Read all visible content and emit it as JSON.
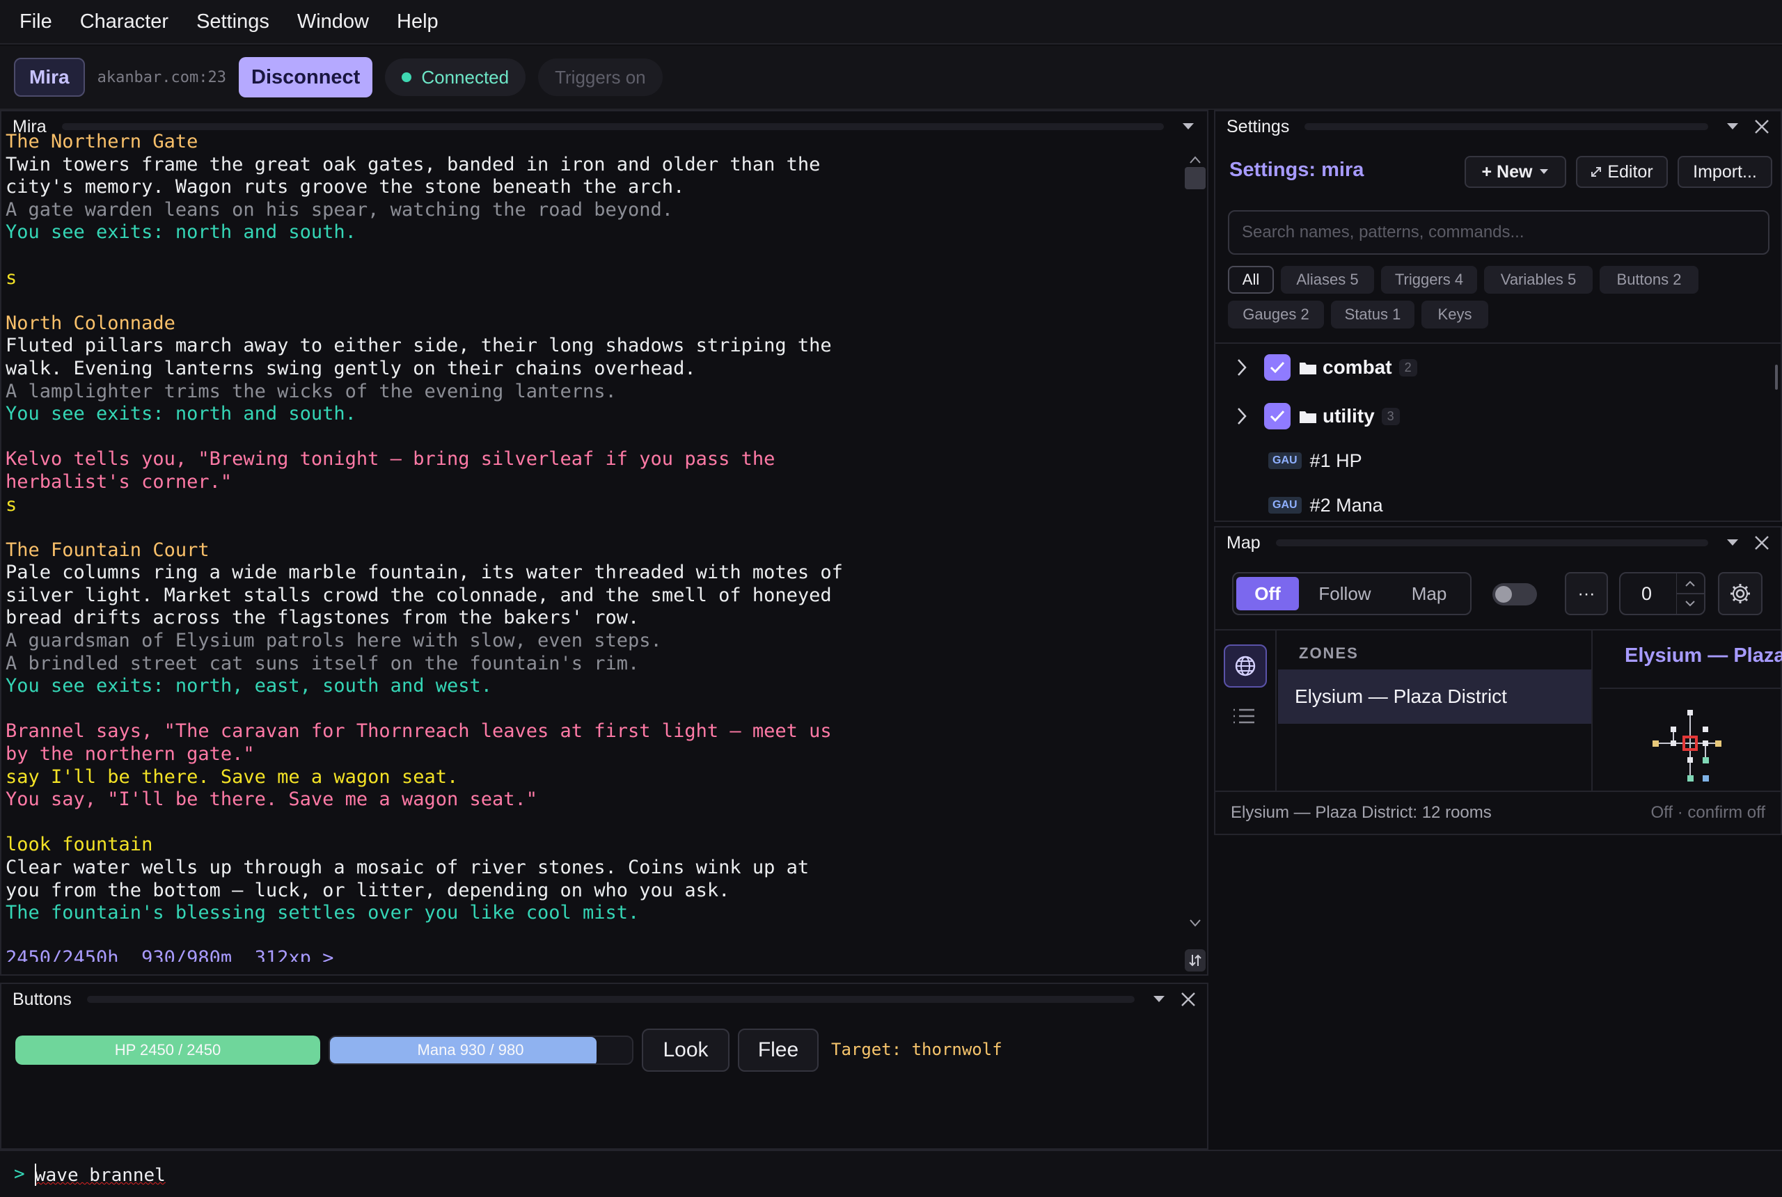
{
  "menu": [
    "File",
    "Character",
    "Settings",
    "Window",
    "Help"
  ],
  "connection": {
    "character": "Mira",
    "host": "akanbar.com:23",
    "disconnect": "Disconnect",
    "status": "Connected",
    "triggers": "Triggers on"
  },
  "output": {
    "title": "Mira",
    "lines": [
      {
        "t": "The Northern Gate",
        "c": "room"
      },
      {
        "t": "Twin towers frame the great oak gates, banded in iron and older than the",
        "c": "desc"
      },
      {
        "t": "city's memory. Wagon ruts groove the stone beneath the arch.",
        "c": "desc"
      },
      {
        "t": "A gate warden leans on his spear, watching the road beyond.",
        "c": "npc"
      },
      {
        "t": "You see exits: north and south.",
        "c": "exit"
      },
      {
        "t": "",
        "c": "desc"
      },
      {
        "t": "s",
        "c": "cmd"
      },
      {
        "t": "",
        "c": "desc"
      },
      {
        "t": "North Colonnade",
        "c": "room"
      },
      {
        "t": "Fluted pillars march away to either side, their long shadows striping the",
        "c": "desc"
      },
      {
        "t": "walk. Evening lanterns swing gently on their chains overhead.",
        "c": "desc"
      },
      {
        "t": "A lamplighter trims the wicks of the evening lanterns.",
        "c": "npc"
      },
      {
        "t": "You see exits: north and south.",
        "c": "exit"
      },
      {
        "t": "",
        "c": "desc"
      },
      {
        "t": "Kelvo tells you, \"Brewing tonight — bring silverleaf if you pass the",
        "c": "tell"
      },
      {
        "t": "herbalist's corner.\"",
        "c": "tell"
      },
      {
        "t": "s",
        "c": "cmd"
      },
      {
        "t": "",
        "c": "desc"
      },
      {
        "t": "The Fountain Court",
        "c": "room"
      },
      {
        "t": "Pale columns ring a wide marble fountain, its water threaded with motes of",
        "c": "desc"
      },
      {
        "t": "silver light. Market stalls crowd the colonnade, and the smell of honeyed",
        "c": "desc"
      },
      {
        "t": "bread drifts across the flagstones from the bakers' row.",
        "c": "desc"
      },
      {
        "t": "A guardsman of Elysium patrols here with slow, even steps.",
        "c": "npc"
      },
      {
        "t": "A brindled street cat suns itself on the fountain's rim.",
        "c": "npc"
      },
      {
        "t": "You see exits: north, east, south and west.",
        "c": "exit"
      },
      {
        "t": "",
        "c": "desc"
      },
      {
        "t": "Brannel says, \"The caravan for Thornreach leaves at first light — meet us",
        "c": "tell"
      },
      {
        "t": "by the northern gate.\"",
        "c": "tell"
      },
      {
        "t": "say I'll be there. Save me a wagon seat.",
        "c": "cmd"
      },
      {
        "t": "You say, \"I'll be there. Save me a wagon seat.\"",
        "c": "tell"
      },
      {
        "t": "",
        "c": "desc"
      },
      {
        "t": "look fountain",
        "c": "cmd"
      },
      {
        "t": "Clear water wells up through a mosaic of river stones. Coins wink up at",
        "c": "desc"
      },
      {
        "t": "you from the bottom — luck, or litter, depending on who you ask.",
        "c": "desc"
      },
      {
        "t": "The fountain's blessing settles over you like cool mist.",
        "c": "exit"
      },
      {
        "t": "",
        "c": "desc"
      },
      {
        "t": "2450/2450h  930/980m  312xp >",
        "c": "prompt"
      }
    ]
  },
  "buttons_panel": {
    "title": "Buttons",
    "hp_label": "HP  2450 / 2450",
    "hp_fraction": 1.0,
    "mana_label": "Mana  930 / 980",
    "mana_fraction": 0.949,
    "look": "Look",
    "flee": "Flee",
    "target": "Target: thornwolf"
  },
  "input": {
    "prompt": ">",
    "value": "wave brannel"
  },
  "settings": {
    "panel_title": "Settings",
    "heading": "Settings: mira",
    "new_btn": "+ New",
    "editor_btn": "Editor",
    "import_btn": "Import...",
    "search_placeholder": "Search names, patterns, commands...",
    "chips": [
      "All",
      "Aliases 5",
      "Triggers 4",
      "Variables 5",
      "Buttons 2",
      "Gauges 2",
      "Status 1",
      "Keys"
    ],
    "groups": [
      {
        "name": "combat",
        "count": "2"
      },
      {
        "name": "utility",
        "count": "3"
      }
    ],
    "gauges": [
      {
        "tag": "GAU",
        "name": "#1 HP"
      },
      {
        "tag": "GAU",
        "name": "#2 Mana"
      }
    ]
  },
  "map": {
    "panel_title": "Map",
    "modes": [
      "Off",
      "Follow",
      "Map"
    ],
    "active_mode": "Off",
    "more": "···",
    "level": "0",
    "zones_header": "ZONES",
    "zone_item": "Elysium — Plaza District",
    "zone_title": "Elysium — Plaza District",
    "footer_left": "Elysium — Plaza District: 12 rooms",
    "footer_right": "Off · confirm off"
  },
  "colors": {
    "accent": "#8f7bff",
    "room": "#f9c06a",
    "exit": "#35d6b6",
    "command": "#f3e226",
    "tell": "#ff7aa6",
    "hp": "#6fd69b",
    "mana": "#8fb2f0"
  }
}
